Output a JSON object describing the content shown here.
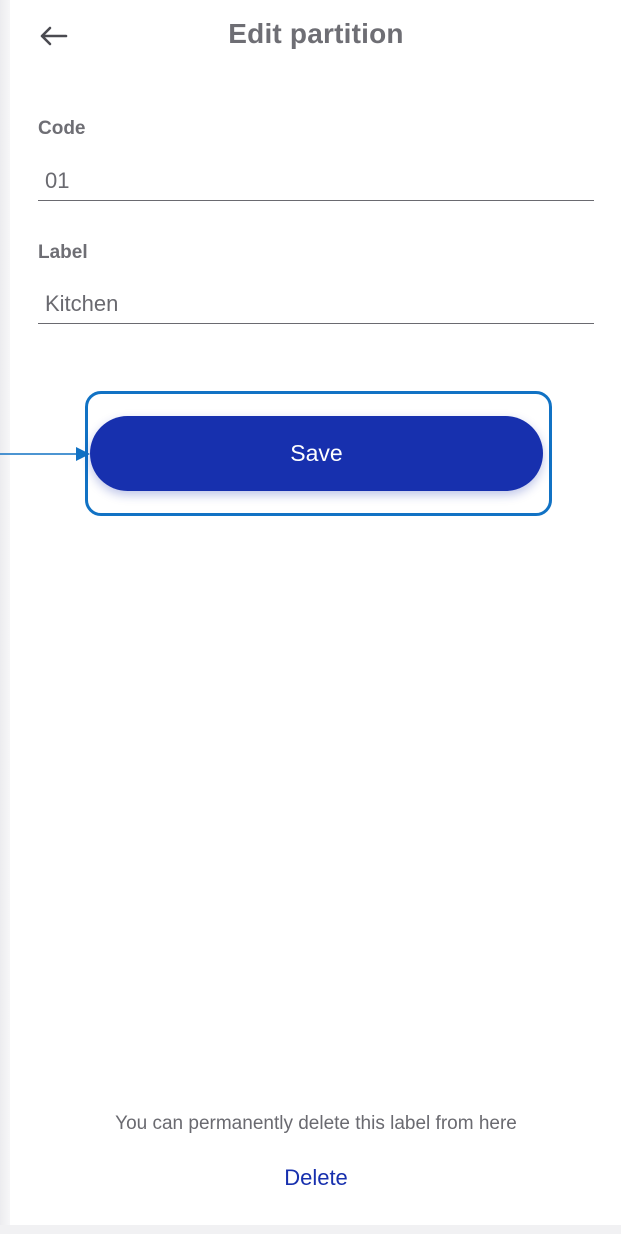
{
  "header": {
    "title": "Edit partition",
    "back_icon": "arrow-left-icon"
  },
  "form": {
    "code": {
      "label": "Code",
      "value": "01"
    },
    "label": {
      "label": "Label",
      "value": "Kitchen"
    }
  },
  "actions": {
    "save_label": "Save"
  },
  "footer": {
    "info_text": "You can permanently delete this label from here",
    "delete_label": "Delete"
  },
  "colors": {
    "primary": "#1730ae",
    "highlight": "#1172c4",
    "text_muted": "#6e6e74"
  }
}
